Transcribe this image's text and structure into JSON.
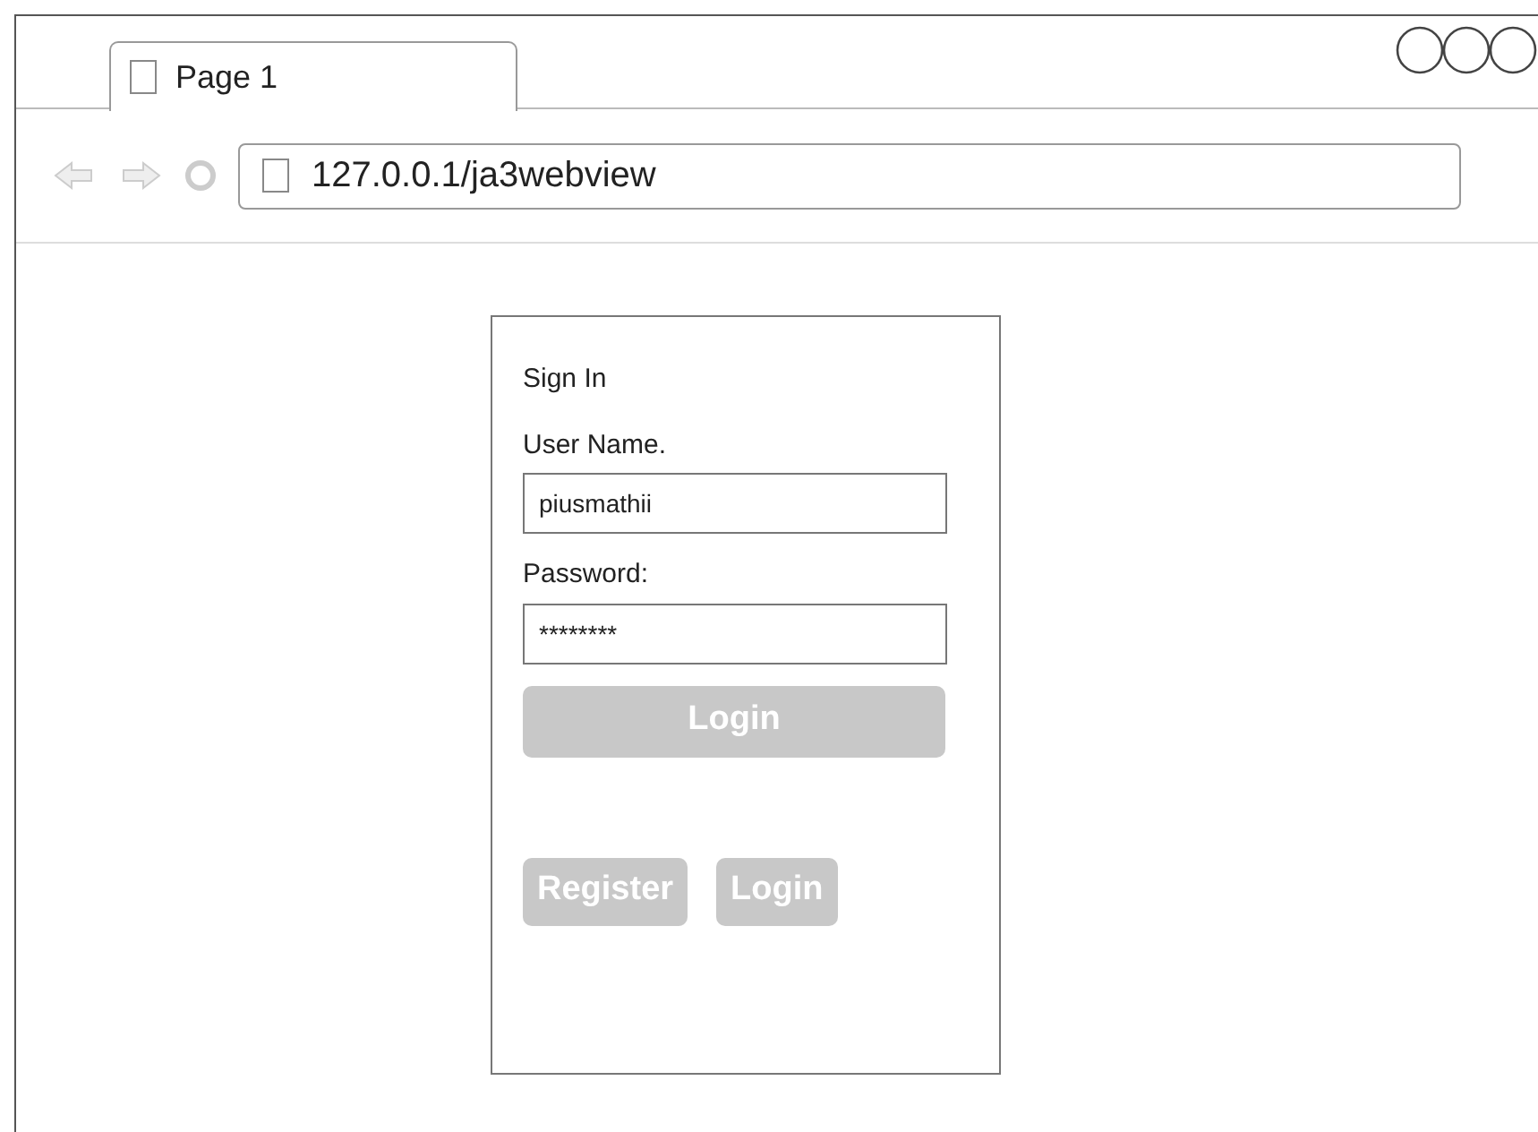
{
  "tabs": [
    {
      "label": "Page 1",
      "selected": true
    }
  ],
  "address_bar": {
    "url": "127.0.0.1/ja3webview"
  },
  "form": {
    "title": "Sign In",
    "fields": [
      {
        "label": "User Name.",
        "value": "piusmathii"
      },
      {
        "label": "Password:",
        "value": "********"
      }
    ],
    "buttons": [
      {
        "label": "Login",
        "disabled": true,
        "kind": "wide"
      },
      {
        "label": "Register",
        "disabled": true,
        "kind": "small"
      },
      {
        "label": "Login",
        "disabled": true,
        "kind": "small"
      }
    ]
  }
}
